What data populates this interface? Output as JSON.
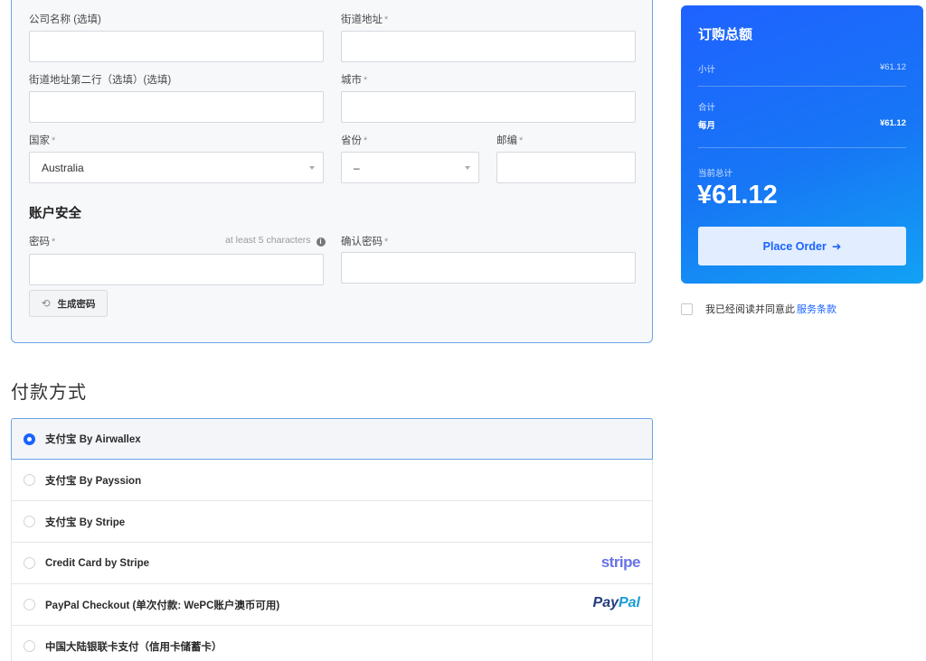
{
  "form": {
    "company": {
      "label": "公司名称 (选填)",
      "value": ""
    },
    "street": {
      "label": "街道地址",
      "required": "*",
      "value": ""
    },
    "street2": {
      "label": "街道地址第二行（选填）(选填)",
      "value": ""
    },
    "city": {
      "label": "城市",
      "required": "*",
      "value": ""
    },
    "country": {
      "label": "国家",
      "required": "*",
      "value": "Australia"
    },
    "state": {
      "label": "省份",
      "required": "*",
      "value": "–"
    },
    "postcode": {
      "label": "邮编",
      "required": "*",
      "value": ""
    }
  },
  "security": {
    "title": "账户安全",
    "password": {
      "label": "密码",
      "required": "*",
      "hint": "at least 5 characters",
      "value": ""
    },
    "confirm": {
      "label": "确认密码",
      "required": "*",
      "value": ""
    },
    "generate_label": "生成密码"
  },
  "summary": {
    "title": "订购总额",
    "subtotal_label": "小计",
    "subtotal_value": "¥61.12",
    "total_label": "合计",
    "monthly_label": "每月",
    "monthly_value": "¥61.12",
    "due_label": "当前总计",
    "due_value": "¥61.12",
    "place_order_label": "Place Order",
    "terms_prefix": "我已经阅读并同意此",
    "terms_link": "服务条款"
  },
  "payment": {
    "title": "付款方式",
    "methods": [
      {
        "label": "支付宝 By Airwallex",
        "selected": true
      },
      {
        "label": "支付宝 By Payssion",
        "selected": false
      },
      {
        "label": "支付宝 By Stripe",
        "selected": false
      },
      {
        "label": "Credit Card by Stripe",
        "selected": false,
        "brand": "stripe"
      },
      {
        "label": "PayPal Checkout (单次付款: WePC账户澳币可用)",
        "selected": false,
        "brand": "PayPal"
      },
      {
        "label": "中国大陆银联卡支付（信用卡储蓄卡）",
        "selected": false
      }
    ],
    "brand_stripe": "stripe",
    "brand_paypal_1": "Pay",
    "brand_paypal_2": "Pal"
  },
  "colors": {
    "accent": "#1a63ff",
    "card_border": "#6aa5e4",
    "stripe": "#6772e5"
  }
}
